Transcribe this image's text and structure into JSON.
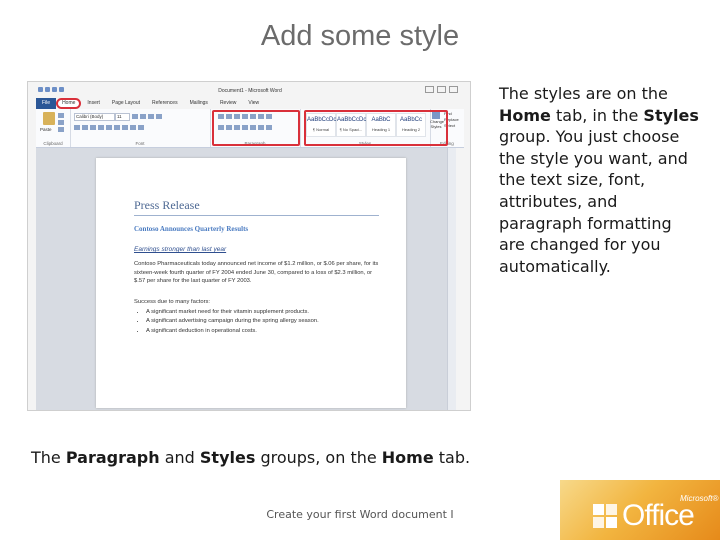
{
  "slide": {
    "title": "Add some style",
    "side_text": {
      "p1": "The styles are on the ",
      "b1": "Home",
      "p2": " tab, in the ",
      "b2": "Styles",
      "p3": " group. You just choose the style you want, and the text size, font, attributes, and paragraph formatting are changed for you automatically."
    },
    "caption": {
      "p1": "The ",
      "b1": "Paragraph",
      "p2": " and ",
      "b2": "Styles",
      "p3": " groups, on the ",
      "b3": "Home",
      "p4": " tab."
    },
    "footer": "Create your first Word document I",
    "logo_text": "Office",
    "logo_ms": "Microsoft®"
  },
  "word": {
    "window_title": "Document1 - Microsoft Word",
    "tabs": [
      "File",
      "Home",
      "Insert",
      "Page Layout",
      "References",
      "Mailings",
      "Review",
      "View"
    ],
    "groups": {
      "clipboard": "Clipboard",
      "font": "Font",
      "paragraph": "Paragraph",
      "styles": "Styles",
      "editing": "Editing"
    },
    "paste_label": "Paste",
    "font_name": "Calibri (Body)",
    "font_size": "11",
    "style_gallery": [
      {
        "sample": "AaBbCcDc",
        "name": "¶ Normal"
      },
      {
        "sample": "AaBbCcDc",
        "name": "¶ No Spaci..."
      },
      {
        "sample": "AaBbC",
        "name": "Heading 1"
      },
      {
        "sample": "AaBbCc",
        "name": "Heading 2"
      }
    ],
    "change_styles": "Change Styles",
    "find": "Find",
    "replace": "Replace",
    "select": "Select"
  },
  "document": {
    "title": "Press Release",
    "subtitle": "Contoso Announces Quarterly Results",
    "heading": "Earnings stronger than last year",
    "paragraph": "Contoso Pharmaceuticals today announced net income of $1.2 million, or $.06 per share, for its sixteen-week fourth quarter of FY 2004 ended June 30, compared to a loss of $2.3 million, or $.57 per share for the last quarter of FY 2003.",
    "list_intro": "Success due to many factors:",
    "bullets": [
      "A significant market need for their vitamin supplement products.",
      "A significant advertising campaign during the spring allergy season.",
      "A significant deduction in operational costs."
    ]
  },
  "colors": {
    "highlight": "#d9303a",
    "file_tab": "#2b5797",
    "title_gray": "#6b6b6b",
    "brand_orange": "#e68a1a"
  }
}
